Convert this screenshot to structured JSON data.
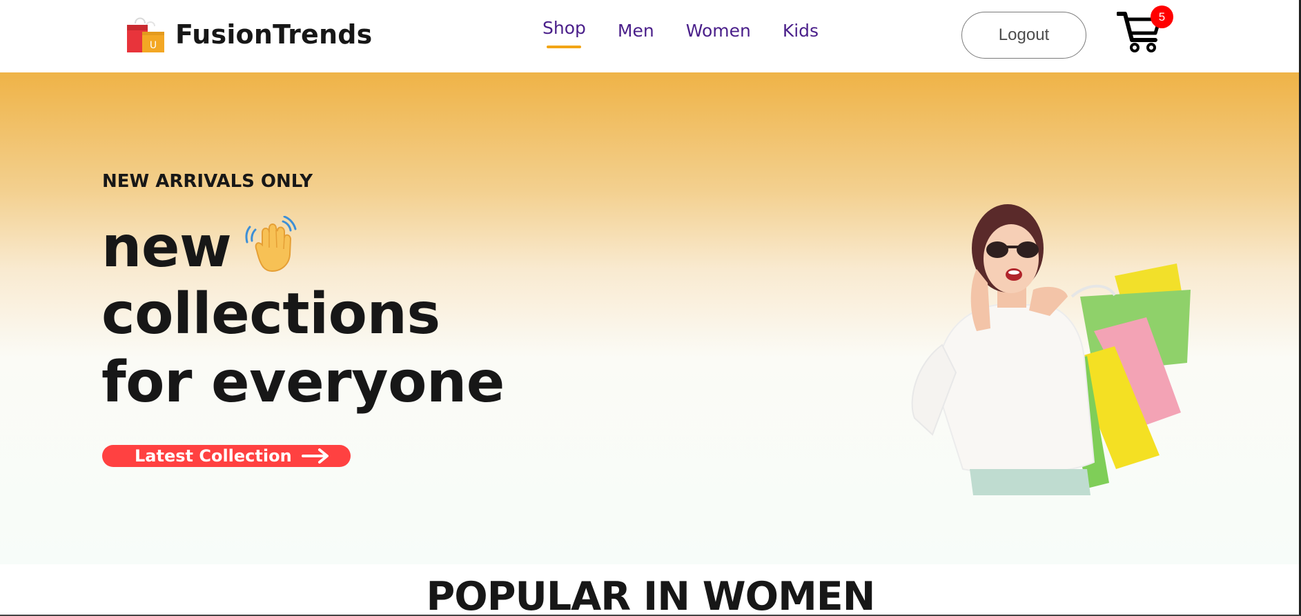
{
  "brand": {
    "name": "FusionTrends",
    "logo_icon": "shopping-bag-icon",
    "logo_letter": "U"
  },
  "nav": {
    "items": [
      {
        "label": "Shop",
        "active": true
      },
      {
        "label": "Men",
        "active": false
      },
      {
        "label": "Women",
        "active": false
      },
      {
        "label": "Kids",
        "active": false
      }
    ]
  },
  "header": {
    "logout_label": "Logout",
    "cart_count": "5",
    "cart_icon": "cart-icon"
  },
  "hero": {
    "kicker": "NEW ARRIVALS ONLY",
    "line1": "new",
    "line2": "collections",
    "line3": "for everyone",
    "emoji": "waving-hand-icon",
    "cta_label": "Latest Collection",
    "cta_icon": "arrow-right-icon",
    "image": "woman-with-shopping-bags-image"
  },
  "popular": {
    "title": "POPULAR IN WOMEN"
  },
  "colors": {
    "brand_text": "#171717",
    "nav_text": "#4a1f8a",
    "nav_active_underline": "#f2a516",
    "cta_background": "#ff4141",
    "cart_badge": "#ff0000",
    "hero_gradient_top": "#efb347",
    "hero_gradient_bottom": "#f7fcf9"
  }
}
